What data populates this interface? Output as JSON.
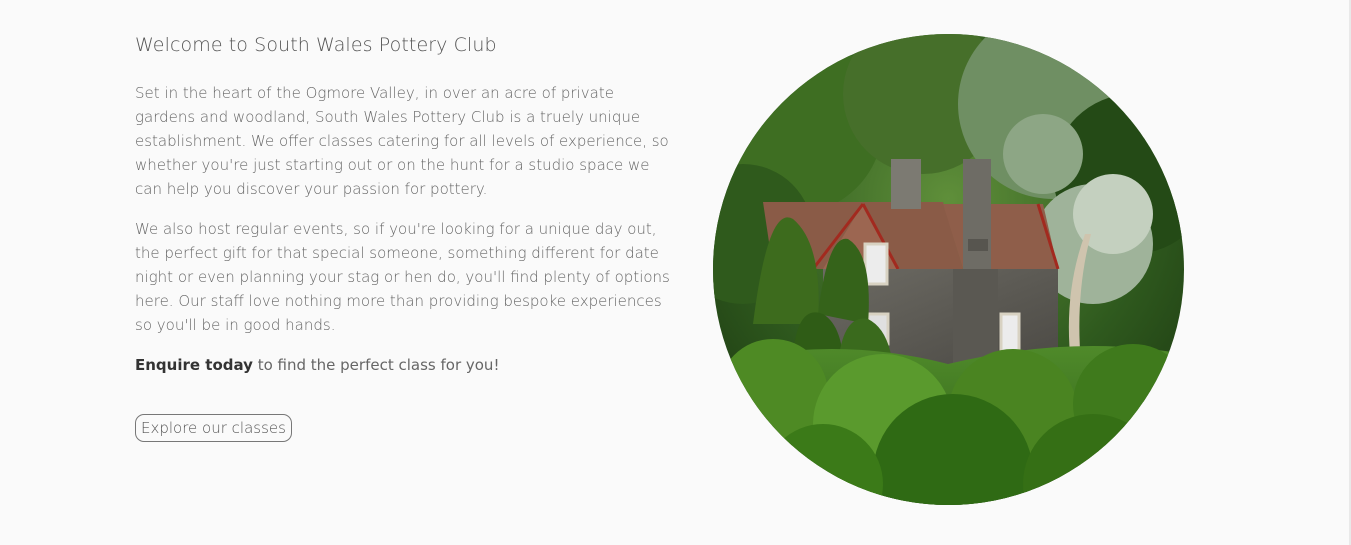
{
  "intro": {
    "heading": "Welcome to South Wales Pottery Club",
    "paragraph_1": "Set in the heart of the Ogmore Valley, in over an acre of private gardens and woodland, South Wales Pottery Club is a truely unique establishment. We offer classes catering for all levels of experience, so whether you're just starting out or on the hunt for a studio space we can help you discover your passion for pottery.",
    "paragraph_2": "We also host regular events, so if you're looking for a unique day out, the perfect gift for that special someone, something different for date night or even planning your stag or hen do, you'll find plenty of options here. Our staff love nothing more than providing bespoke experiences so you'll be in good hands.",
    "enquire_bold": "Enquire today",
    "enquire_rest": " to find the perfect class for you!",
    "cta_label": "Explore our classes"
  },
  "image": {
    "subject": "stone-cottage-in-garden-photo"
  },
  "colors": {
    "background": "#fafafa",
    "text": "#666666",
    "heading": "#555555",
    "button_border": "#777777"
  }
}
